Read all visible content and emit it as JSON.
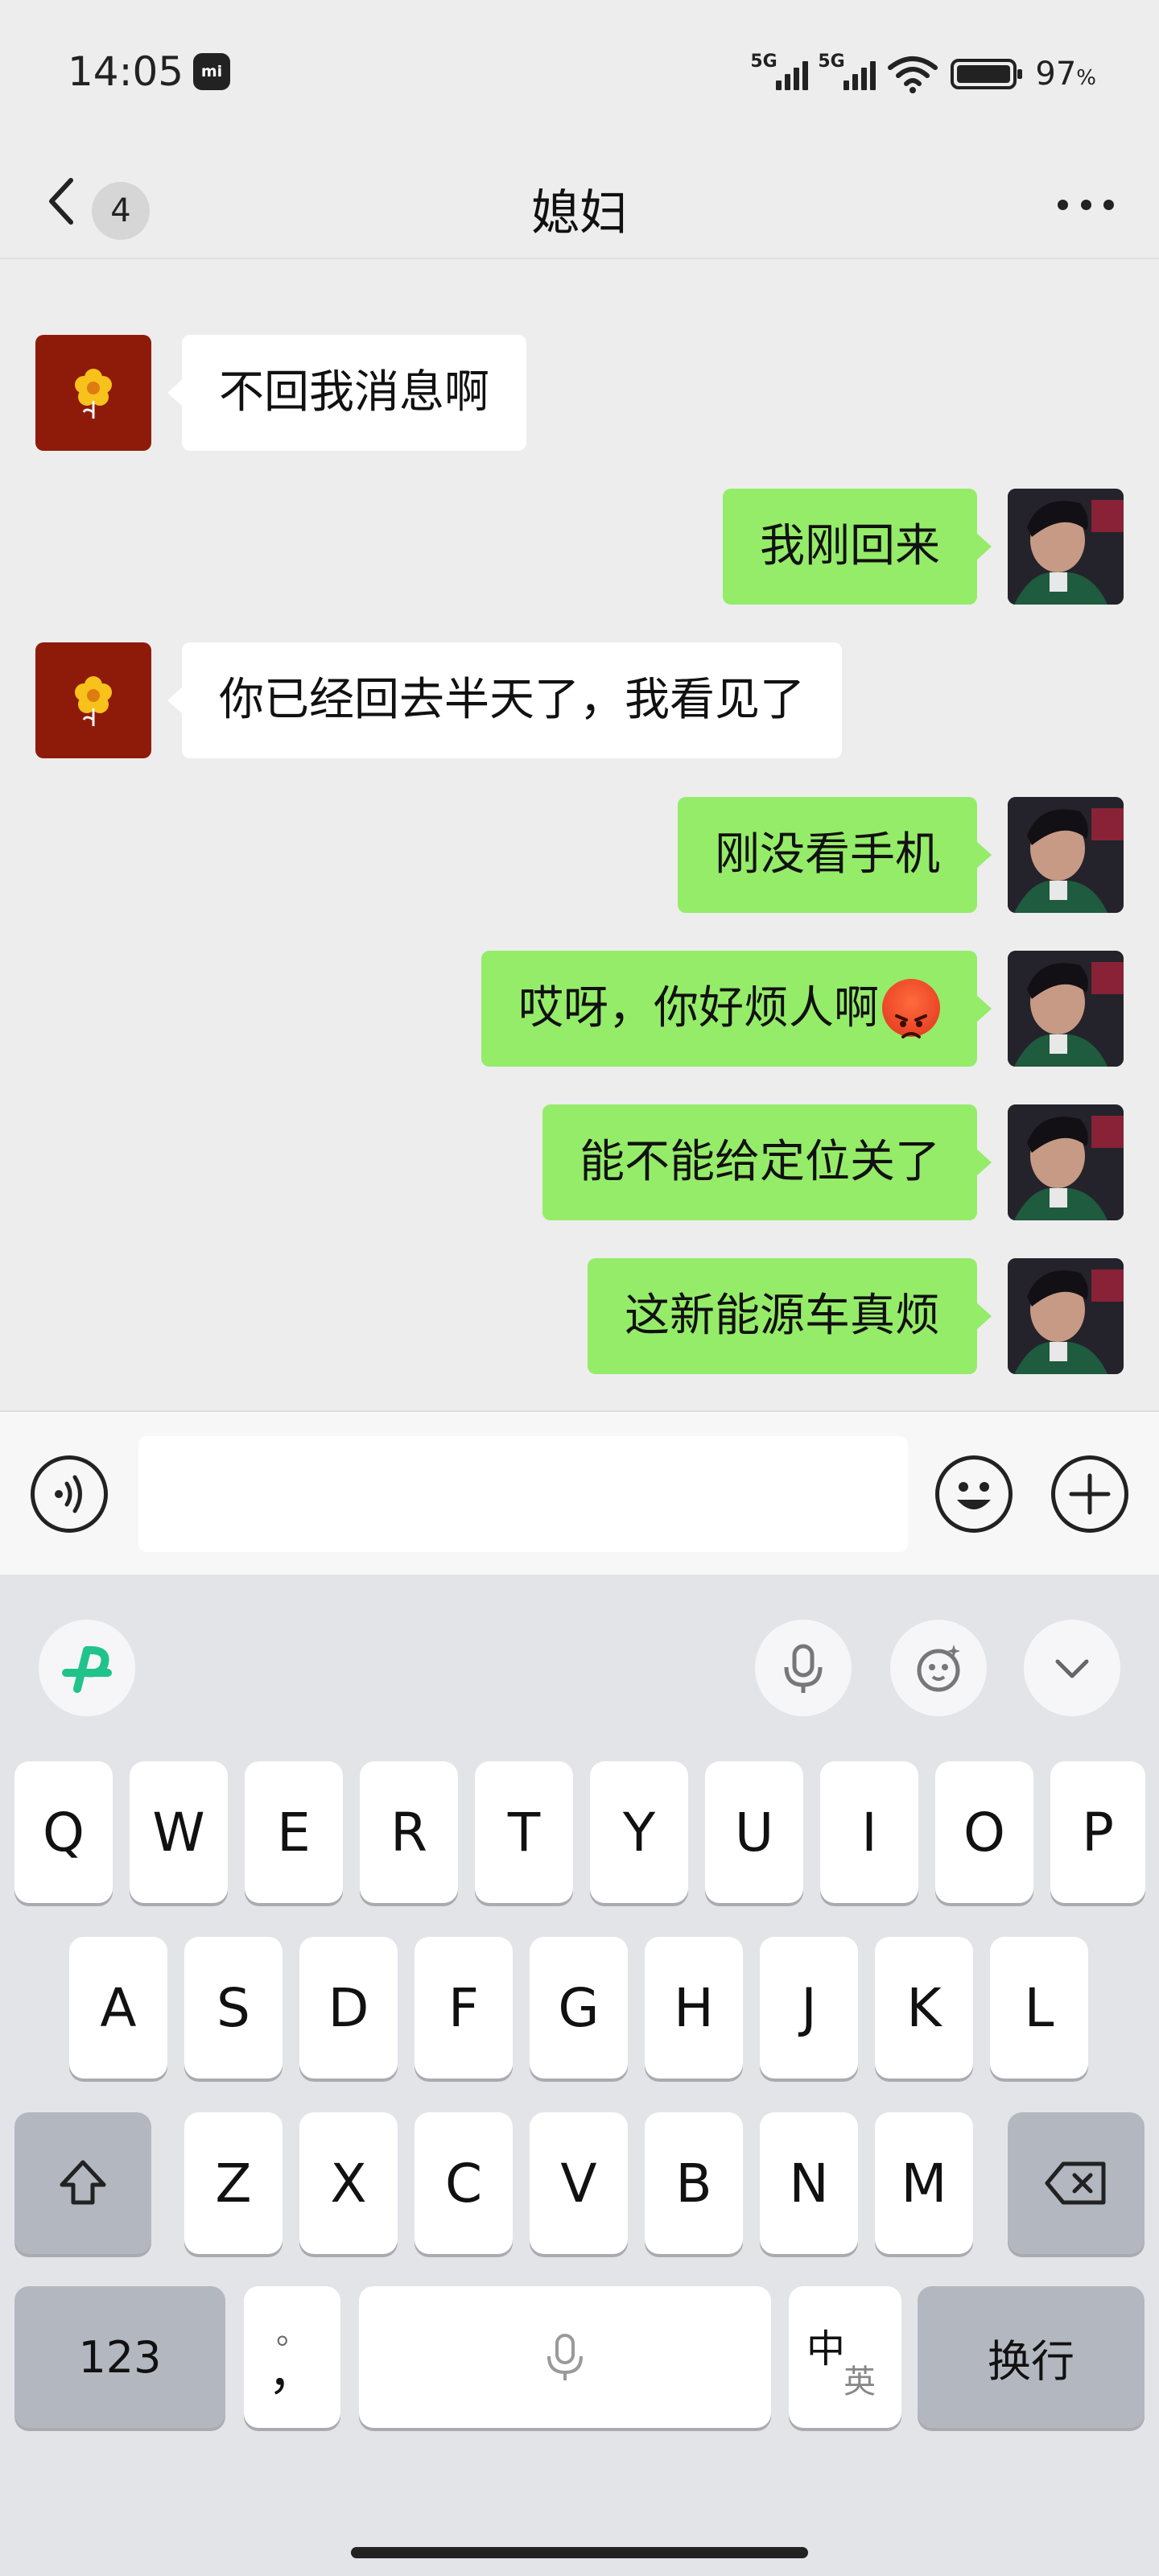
{
  "status_bar": {
    "time": "14:05",
    "mi_label": "mi",
    "signal1_label": "5G",
    "signal2_label": "5G",
    "battery_percent": "97",
    "battery_unit": "%"
  },
  "header": {
    "unread_count": "4",
    "title": "媳妇"
  },
  "messages": [
    {
      "side": "left",
      "text": "不回我消息啊"
    },
    {
      "side": "right",
      "text": "我刚回来"
    },
    {
      "side": "left",
      "text": "你已经回去半天了，我看见了"
    },
    {
      "side": "right",
      "text": "刚没看手机"
    },
    {
      "side": "right",
      "text": "哎呀，你好烦人啊",
      "emoji": "angry-face-emoji"
    },
    {
      "side": "right",
      "text": "能不能给定位关了"
    },
    {
      "side": "right",
      "text": "这新能源车真烦"
    }
  ],
  "input": {
    "placeholder": ""
  },
  "keyboard": {
    "row1": [
      "Q",
      "W",
      "E",
      "R",
      "T",
      "Y",
      "U",
      "I",
      "O",
      "P"
    ],
    "row2": [
      "A",
      "S",
      "D",
      "F",
      "G",
      "H",
      "J",
      "K",
      "L"
    ],
    "row3": [
      "Z",
      "X",
      "C",
      "V",
      "B",
      "N",
      "M"
    ],
    "numbers_key": "123",
    "punct_top": "。",
    "punct_bottom": "，",
    "lang_zh": "中",
    "lang_en": "英",
    "enter_key": "换行"
  },
  "colors": {
    "sent_bubble": "#95ec69",
    "received_bubble": "#ffffff",
    "chat_background": "#ededed",
    "keyboard_background": "#e3e4e8",
    "brand_logo": "#20c389"
  },
  "icons": [
    "back-icon",
    "more-icon",
    "voice-icon",
    "emoji-icon",
    "add-icon",
    "ime-logo-icon",
    "mic-icon",
    "sticker-icon",
    "collapse-icon",
    "shift-icon",
    "backspace-icon",
    "space-mic-icon"
  ]
}
